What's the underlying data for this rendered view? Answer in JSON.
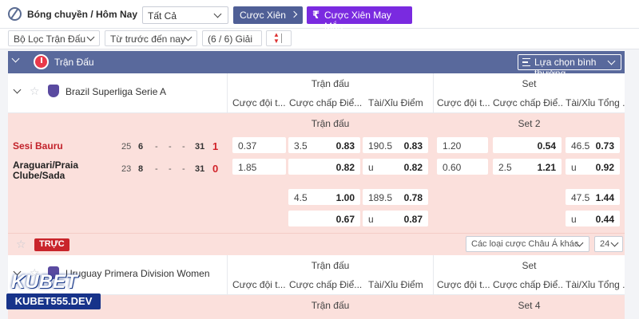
{
  "topbar": {
    "title": "Bóng chuyền / Hôm Nay",
    "select_value": "Tất Cả",
    "btn_xien": "Cược Xiên",
    "btn_may_man": "Cược Xiên May Mắn"
  },
  "filters": {
    "loc": "Bộ Lọc Trận Đấu",
    "time": "Từ trước đến nay",
    "count": "(6 / 6) Giải"
  },
  "section": {
    "title": "Trận Đấu",
    "sort_select": "Lựa chọn bình thường"
  },
  "groups": {
    "match": "Trận đấu",
    "set": "Set"
  },
  "columns": [
    "Cược đội t...",
    "Cược chấp Điể...",
    "Tài/Xỉu Điểm",
    "Cược đội t...",
    "Cược chấp Điể...",
    "Tài/Xỉu Tổng ..."
  ],
  "league1": {
    "name": "Brazil Superliga Serie A"
  },
  "match1": {
    "tab_match": "Trận đấu",
    "tab_set": "Set 2",
    "home": {
      "name": "Sesi Bauru",
      "s1": "25",
      "s2": "6",
      "s3": "-",
      "s4": "-",
      "s5": "-",
      "pts": "31",
      "sets": "1"
    },
    "away": {
      "name_line1": "Araguari/Praia",
      "name_line2": "Clube/Sada",
      "s1": "23",
      "s2": "8",
      "s3": "-",
      "s4": "-",
      "s5": "-",
      "pts": "31",
      "sets": "0"
    },
    "r1": {
      "c1": "0.37",
      "c2l": "3.5",
      "c2r": "0.83",
      "c3l": "190.5",
      "c3r": "0.83",
      "c4": "1.20",
      "c5": "0.54",
      "c6l": "46.5",
      "c6r": "0.73"
    },
    "r2": {
      "c1": "1.85",
      "c2r": "0.82",
      "c3l": "u",
      "c3r": "0.82",
      "c4": "0.60",
      "c5l": "2.5",
      "c5r": "1.21",
      "c6l": "u",
      "c6r": "0.92"
    },
    "r3": {
      "c2l": "4.5",
      "c2r": "1.00",
      "c3l": "189.5",
      "c3r": "0.78",
      "c6l": "47.5",
      "c6r": "1.44"
    },
    "r4": {
      "c2r": "0.67",
      "c3l": "u",
      "c3r": "0.87",
      "c6l": "u",
      "c6r": "0.44"
    }
  },
  "live": {
    "badge": "TRỰC",
    "bet_type": "Các loại cược Châu Á khác",
    "num": "24"
  },
  "league2": {
    "name": "Uruguay Primera Division Women"
  },
  "match2": {
    "tab_match": "Trận đấu",
    "tab_set": "Set 4"
  },
  "brand": {
    "logo": "KUBET",
    "url": "KUBET555.DEV"
  }
}
